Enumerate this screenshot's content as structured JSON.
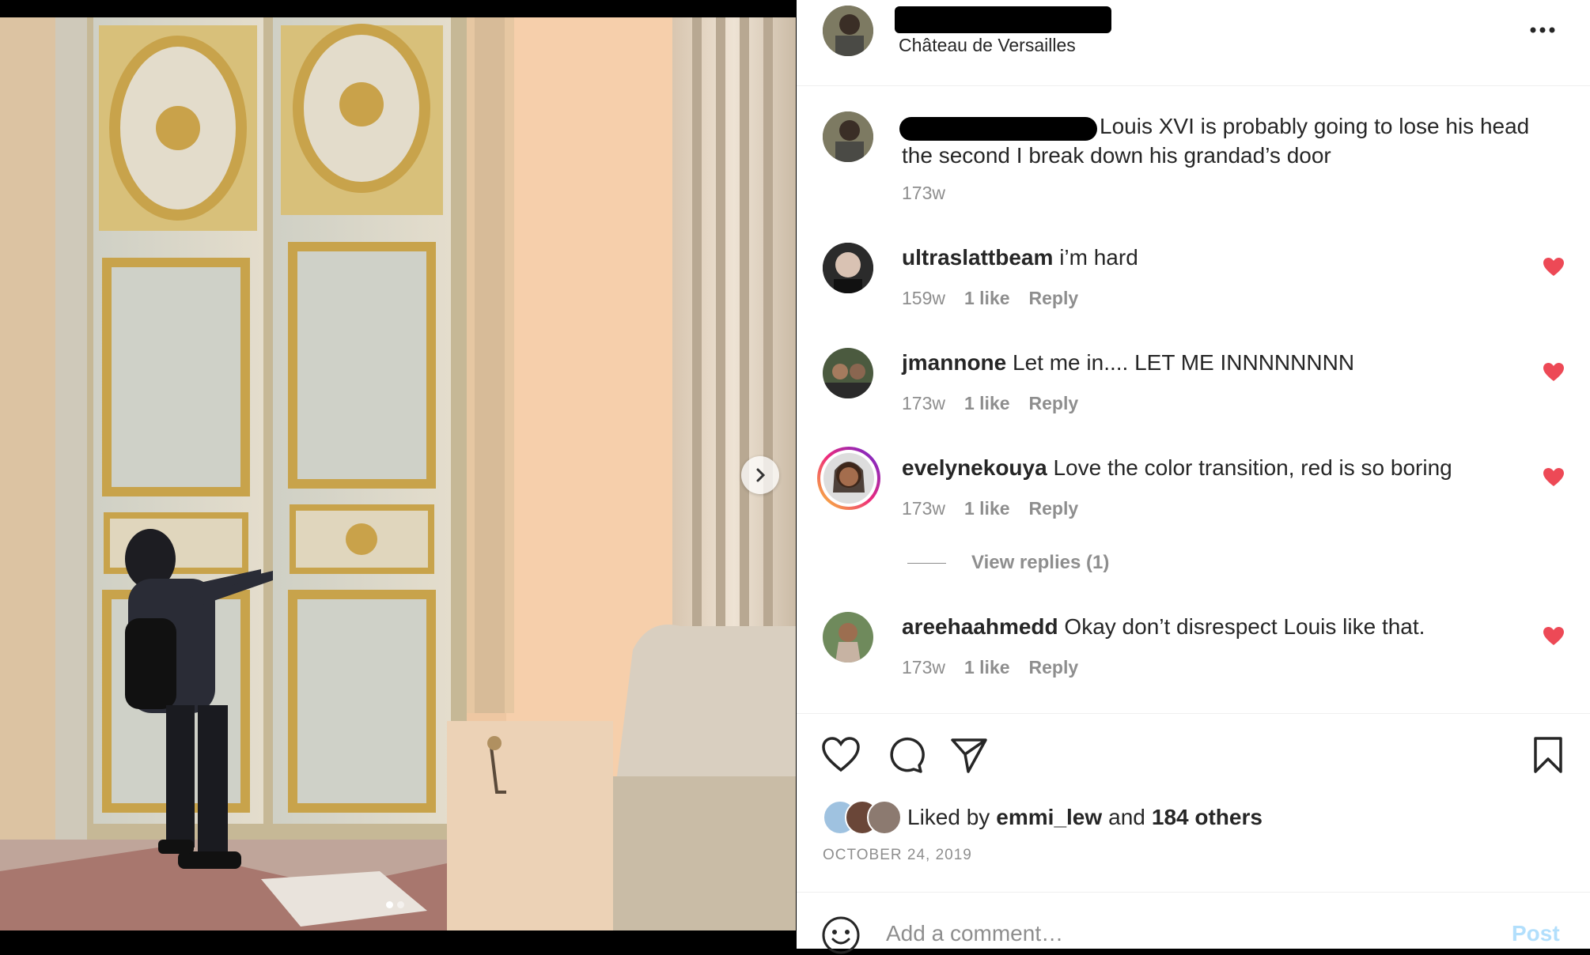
{
  "post": {
    "location": "Château de Versailles",
    "caption": "Louis XVI is probably going to lose his head the second I break down his grandad’s door",
    "caption_age": "173w",
    "likes": {
      "prefix": "Liked by",
      "user": "emmi_lew",
      "joiner": "and",
      "others": "184 others"
    },
    "date": "OCTOBER 24, 2019"
  },
  "comments": [
    {
      "user": "ultraslattbeam",
      "text": "i’m hard",
      "age": "159w",
      "likes": "1 like",
      "reply": "Reply"
    },
    {
      "user": "jmannone",
      "text": "Let me in.... LET ME INNNNNNNN",
      "age": "173w",
      "likes": "1 like",
      "reply": "Reply"
    },
    {
      "user": "evelynekouya",
      "text": "Love the color transition, red is so boring",
      "age": "173w",
      "likes": "1 like",
      "reply": "Reply"
    },
    {
      "user": "areehaahmedd",
      "text": "Okay don’t disrespect Louis like that.",
      "age": "173w",
      "likes": "1 like",
      "reply": "Reply"
    }
  ],
  "view_replies": "View replies (1)",
  "add_comment": {
    "placeholder": "Add a comment…",
    "post_label": "Post"
  },
  "icons": {
    "more": "more-icon",
    "heart": "heart-icon",
    "comment": "comment-icon",
    "share": "share-icon",
    "bookmark": "bookmark-icon",
    "emoji": "emoji-icon",
    "next": "chevron-right-icon"
  },
  "colors": {
    "like_red": "#ed4956",
    "muted_text": "#8e8e8e",
    "post_disabled": "#b2dffc",
    "story_ring": "#d6249f"
  }
}
